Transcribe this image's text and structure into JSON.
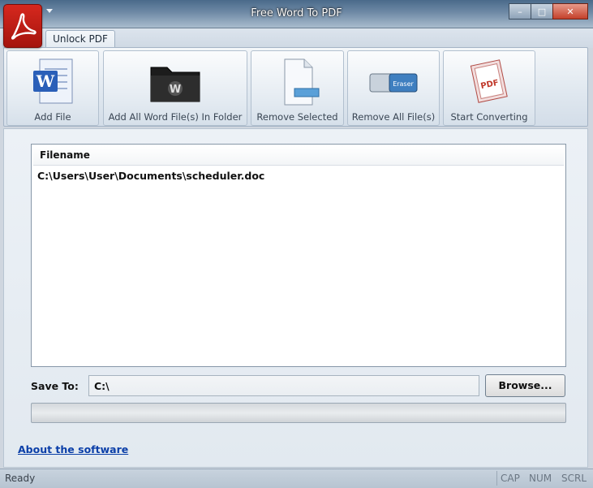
{
  "window": {
    "title": "Free Word To PDF",
    "minimize_glyph": "–",
    "maximize_glyph": "□",
    "close_glyph": "✕"
  },
  "tabs": [
    {
      "label": "Unlock PDF"
    }
  ],
  "ribbon": {
    "buttons": [
      {
        "label": "Add File",
        "icon": "word-document-icon"
      },
      {
        "label": "Add All Word File(s) In Folder",
        "icon": "folder-icon"
      },
      {
        "label": "Remove Selected",
        "icon": "remove-document-icon"
      },
      {
        "label": "Remove All File(s)",
        "icon": "eraser-icon"
      },
      {
        "label": "Start Converting",
        "icon": "pdf-icon"
      }
    ]
  },
  "file_list": {
    "column_header": "Filename",
    "rows": [
      "C:\\Users\\User\\Documents\\scheduler.doc"
    ]
  },
  "save": {
    "label": "Save To:",
    "value": "C:\\",
    "browse_label": "Browse..."
  },
  "progress": {
    "value": 0
  },
  "about": {
    "link_text": "About the software"
  },
  "status": {
    "text": "Ready",
    "indicators": [
      "CAP",
      "NUM",
      "SCRL"
    ]
  },
  "colors": {
    "app_icon": "#c81e14",
    "link": "#0b3fa8",
    "title_bar": "#5b7896"
  }
}
